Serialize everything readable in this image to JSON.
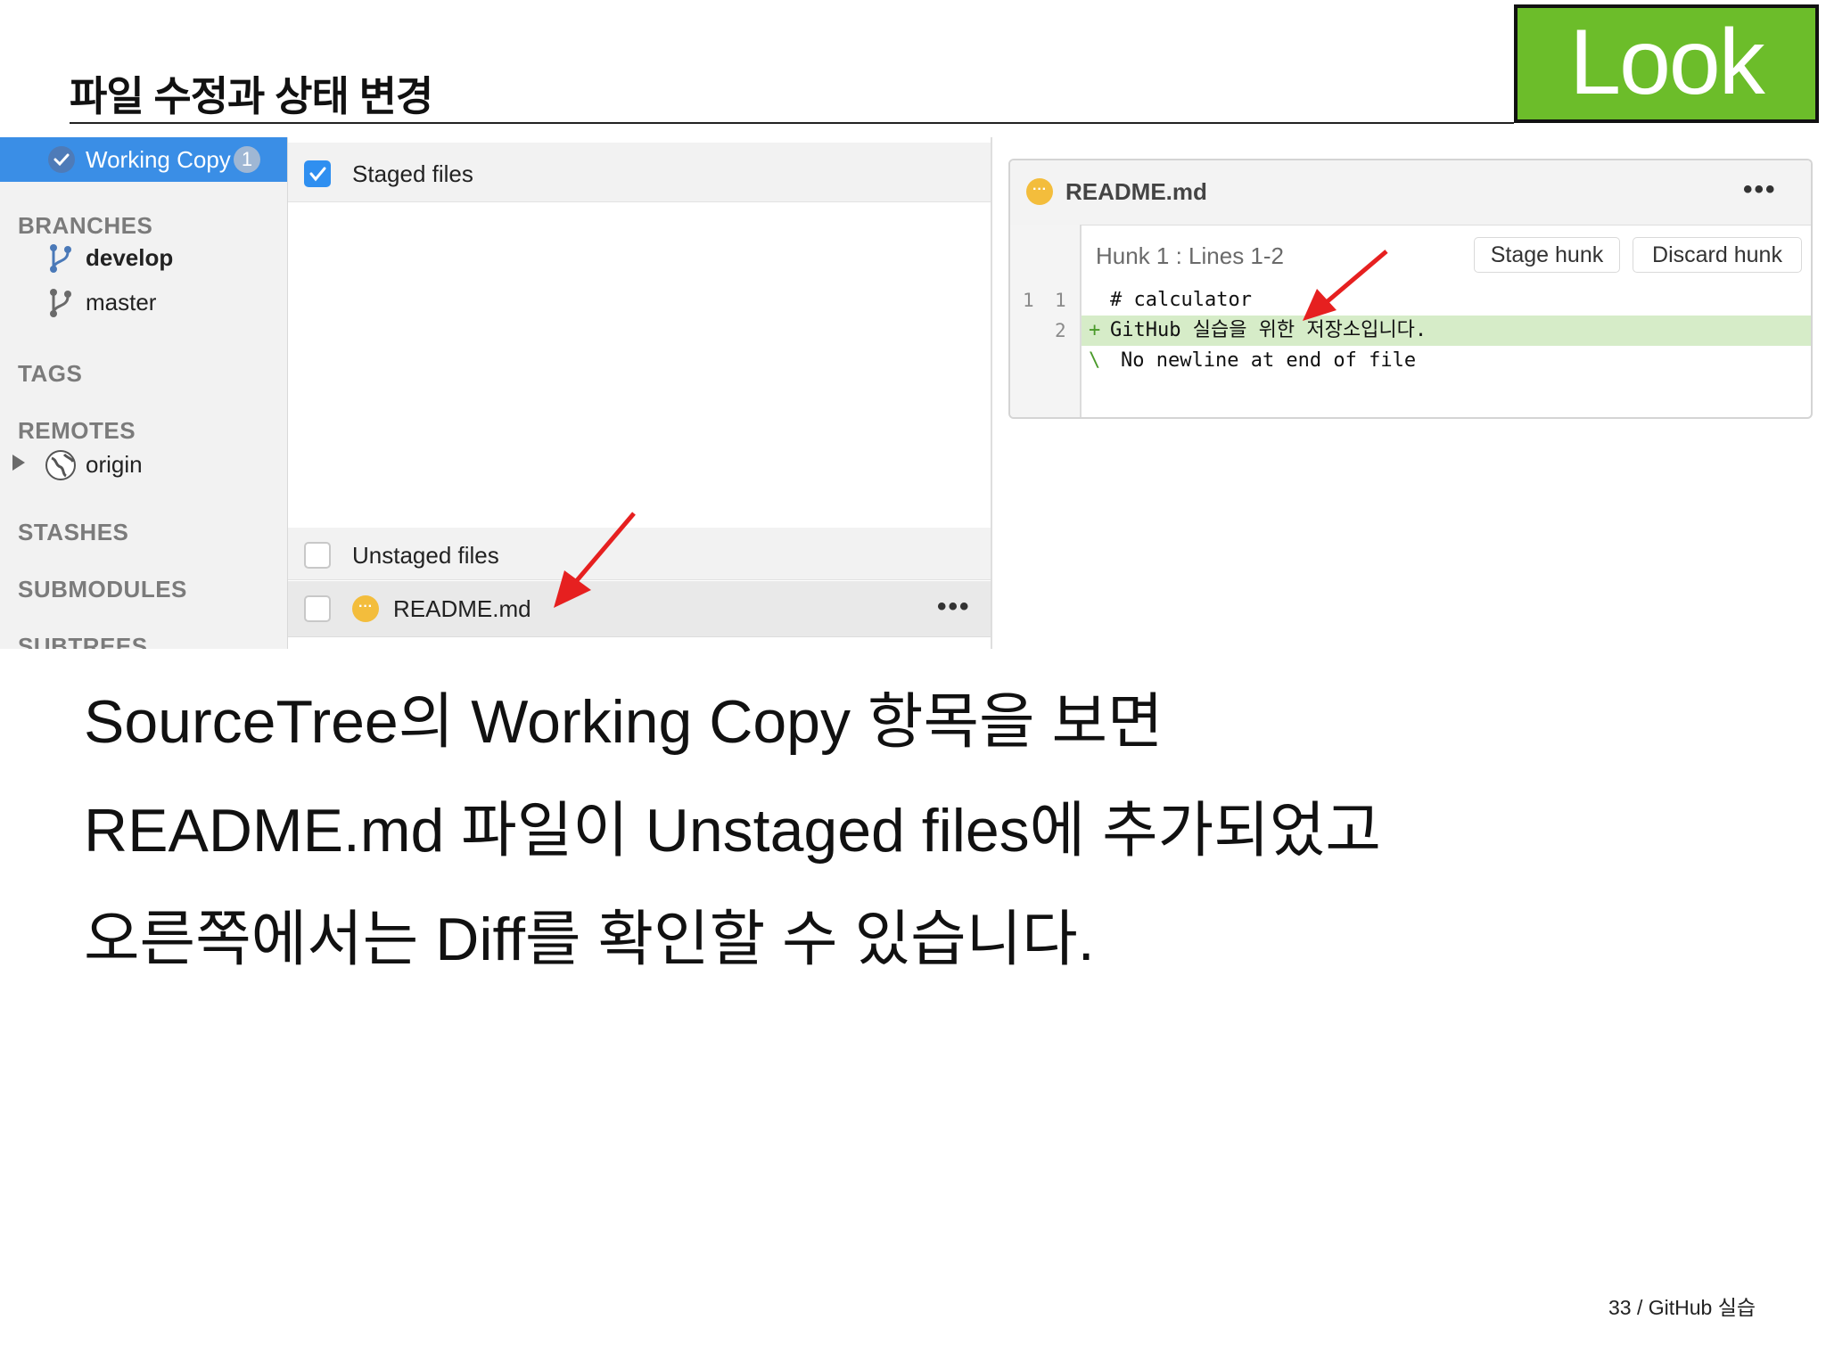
{
  "slide": {
    "title": "파일 수정과 상태 변경",
    "badge": "Look",
    "body_lines": [
      "SourceTree의  Working Copy  항목을  보면",
      "README.md  파일이  Unstaged files에  추가되었고",
      "오른쪽에서는  Diff를  확인할  수  있습니다."
    ],
    "footer": "33 / GitHub 실습"
  },
  "sidebar": {
    "working_copy_label": "Working Copy",
    "working_copy_count": "1",
    "sections": {
      "branches": "BRANCHES",
      "tags": "TAGS",
      "remotes": "REMOTES",
      "stashes": "STASHES",
      "submodules": "SUBMODULES",
      "subtrees": "SUBTREES"
    },
    "branches": [
      "develop",
      "master"
    ],
    "current_branch": "develop",
    "remotes": [
      "origin"
    ]
  },
  "files": {
    "staged_label": "Staged files",
    "staged_checked": true,
    "unstaged_label": "Unstaged files",
    "unstaged_checked": false,
    "unstaged_items": [
      "README.md"
    ],
    "more_glyph": "•••"
  },
  "diff": {
    "filename": "README.md",
    "more_glyph": "•••",
    "hunk_label": "Hunk 1 : Lines 1-2",
    "stage_hunk_label": "Stage hunk",
    "discard_hunk_label": "Discard hunk",
    "lines": [
      {
        "old": "1",
        "new": "1",
        "marker": " ",
        "text": "# calculator"
      },
      {
        "old": "",
        "new": "2",
        "marker": "+",
        "text": "GitHub 실습을 위한 저장소입니다."
      },
      {
        "old": "",
        "new": "",
        "marker": "\\",
        "text": "No newline at end of file"
      }
    ]
  },
  "colors": {
    "badge_green": "#6cbd2a",
    "selection_blue": "#3a8ee6",
    "added_line_green": "#d6ecc8",
    "pending_yellow": "#f3bd3c",
    "annotation_red": "#e62020"
  },
  "icons": {
    "working_copy": "working-copy-icon",
    "branch": "branch-icon",
    "remote": "globe-icon",
    "pending": "pending-file-icon",
    "annotation": "red-arrow-icon"
  }
}
